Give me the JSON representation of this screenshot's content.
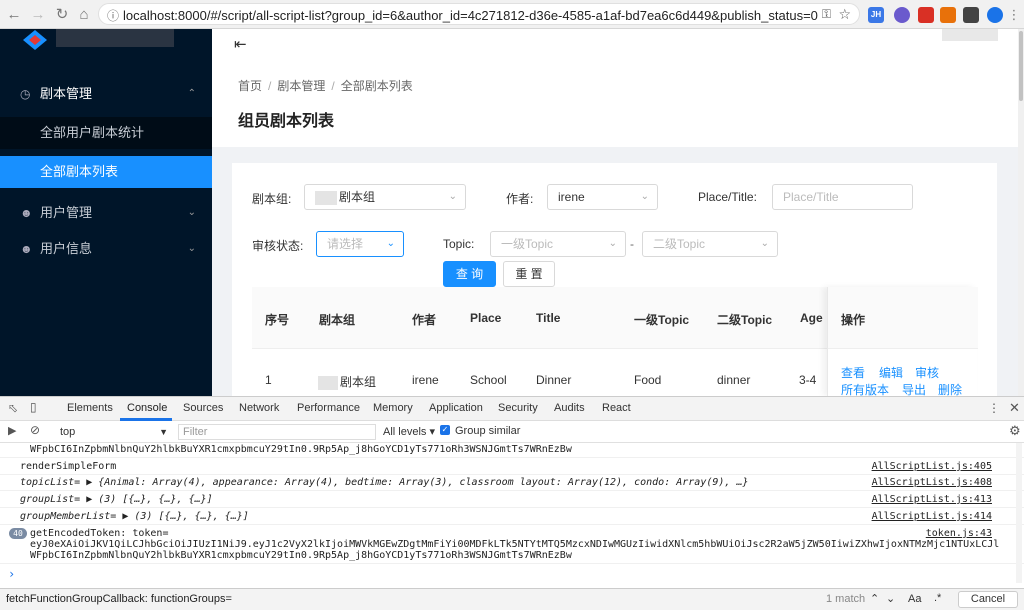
{
  "browser": {
    "url": "localhost:8000/#/script/all-script-list?group_id=6&author_id=4c271812-d36e-4585-a1af-bd7ea6c6d449&publish_status=0",
    "ext_labels": [
      "JH",
      "",
      "",
      "",
      "",
      ""
    ]
  },
  "sidebar": {
    "menu_script": "剧本管理",
    "sub_stats": "全部用户剧本统计",
    "sub_list": "全部剧本列表",
    "menu_users": "用户管理",
    "menu_userinfo": "用户信息"
  },
  "breadcrumb": {
    "home": "首页",
    "mgmt": "剧本管理",
    "current": "全部剧本列表",
    "sep": "/"
  },
  "page_title": "组员剧本列表",
  "form": {
    "group_label": "剧本组:",
    "group_value": "剧本组",
    "author_label": "作者:",
    "author_value": "irene",
    "place_label": "Place/Title:",
    "place_placeholder": "Place/Title",
    "status_label": "审核状态:",
    "status_placeholder": "请选择",
    "topic_label": "Topic:",
    "topic1_placeholder": "一级Topic",
    "topic_dash": "-",
    "topic2_placeholder": "二级Topic",
    "search_btn": "查 询",
    "reset_btn": "重 置"
  },
  "table": {
    "headers": [
      "序号",
      "剧本组",
      "作者",
      "Place",
      "Title",
      "一级Topic",
      "二级Topic",
      "Age",
      "操作"
    ],
    "row": {
      "index": "1",
      "group": "剧本组",
      "author": "irene",
      "place": "School",
      "title": "Dinner",
      "topic1": "Food",
      "topic2": "dinner",
      "age": "3-4"
    },
    "ops": {
      "view": "查看",
      "edit": "编辑",
      "review": "审核",
      "versions": "所有版本",
      "export": "导出",
      "delete": "删除"
    }
  },
  "devtools": {
    "tabs": [
      "Elements",
      "Console",
      "Sources",
      "Network",
      "Performance",
      "Memory",
      "Application",
      "Security",
      "Audits",
      "React"
    ],
    "context": "top",
    "filter_placeholder": "Filter",
    "levels": "All levels ▾",
    "group_similar": "Group similar",
    "lines": {
      "l0": "WFpbCI6InZpbmNlbnQuY2hlbkBuYXR1cmxpbmcuY29tIn0.9Rp5Ap_j8hGoYCD1yTs771oRh3WSNJGmtTs7WRnEzBw",
      "l1": "renderSimpleForm",
      "l1_src": "AllScriptList.js:405",
      "l2": "topicList= ▶ {Animal: Array(4), appearance: Array(4), bedtime: Array(3), classroom layout: Array(12), condo: Array(9), …}",
      "l2_src": "AllScriptList.js:408",
      "l3": "groupList= ▶ (3) [{…}, {…}, {…}]",
      "l3_src": "AllScriptList.js:413",
      "l4": "groupMemberList= ▶ (3) [{…}, {…}, {…}]",
      "l4_src": "AllScriptList.js:414",
      "l5_badge": "40",
      "l5": "getEncodedToken: token=",
      "l5_src": "token.js:43",
      "l6": "eyJ0eXAiOiJKV1QiLCJhbGciOiJIUzI1NiJ9.eyJ1c2VyX2lkIjoiMWVkMGEwZDgtMmFiYi00MDFkLTk5NTYtMTQ5MzcxNDIwMGUzIiwidXNlcm5hbWUiOiJsc2R2aW5jZW50IiwiZXhwIjoxNTMzMjc1NTUxLCJlb",
      "l7": "WFpbCI6InZpbmNlbnQuY2hlbkBuYXR1cmxpbmcuY29tIn0.9Rp5Ap_j8hGoYCD1yTs771oRh3WSNJGmtTs7WRnEzBw",
      "prompt": "›"
    },
    "find": {
      "query": "fetchFunctionGroupCallback: functionGroups=",
      "count": "1 match",
      "aa": "Aa",
      "regex": ".*",
      "cancel": "Cancel"
    }
  }
}
